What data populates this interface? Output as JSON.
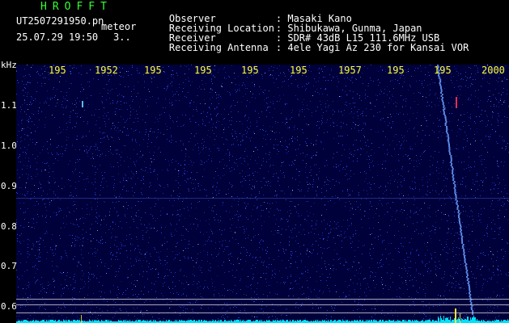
{
  "header": {
    "app_name": "HROFFT",
    "file_name": "UT2507291950.pn",
    "file_suffix": "meteor",
    "timestamp": "25.07.29 19:50",
    "count": "3.."
  },
  "station": {
    "observer": {
      "label": "Observer",
      "value": ": Masaki Kano"
    },
    "location": {
      "label": "Receiving Location",
      "value": ": Shibukawa, Gunma, Japan"
    },
    "receiver": {
      "label": "Receiver",
      "value": ": SDR# 43dB L15 111.6MHz USB"
    },
    "antenna": {
      "label": "Receiving Antenna",
      "value": ": 4ele Yagi Az 230 for Kansai VOR"
    }
  },
  "axis": {
    "unit": "kHz",
    "y_ticks": [
      "1.1",
      "1.0",
      "0.9",
      "0.8",
      "0.7",
      "0.6"
    ],
    "x_ticks": [
      "195",
      "1952",
      "195",
      "195",
      "195",
      "195",
      "1957",
      "195",
      "195",
      "2000"
    ]
  },
  "colors": {
    "background": "#00003a",
    "noise": "#2b4cff",
    "trace": "#6aa0ff",
    "baseline": "#00e0ff",
    "tick_label": "#ffff33",
    "app_name": "#33ff33"
  }
}
